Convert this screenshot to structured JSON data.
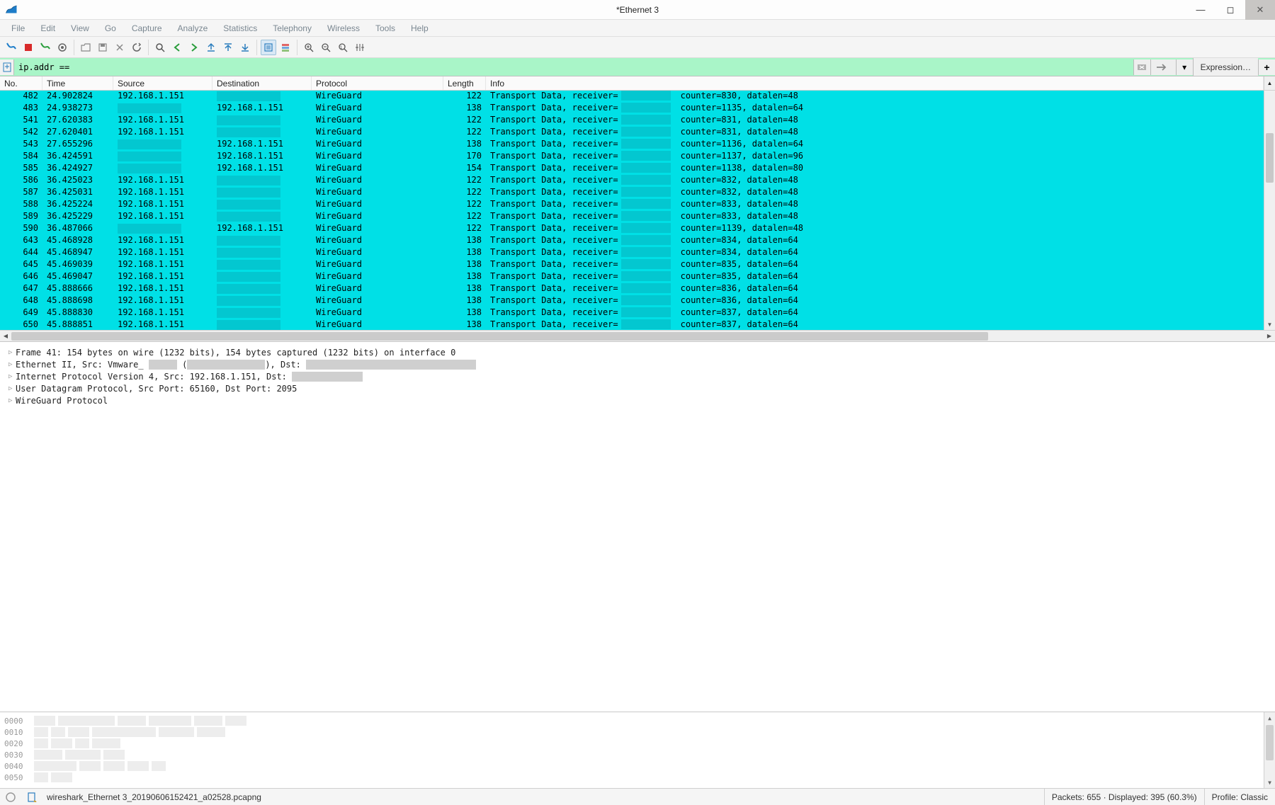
{
  "window": {
    "title": "*Ethernet 3"
  },
  "menu": [
    "File",
    "Edit",
    "View",
    "Go",
    "Capture",
    "Analyze",
    "Statistics",
    "Telephony",
    "Wireless",
    "Tools",
    "Help"
  ],
  "filter": {
    "value": "ip.addr ==",
    "expression_label": "Expression…"
  },
  "columns": {
    "no": "No.",
    "time": "Time",
    "source": "Source",
    "destination": "Destination",
    "protocol": "Protocol",
    "length": "Length",
    "info": "Info"
  },
  "packets": [
    {
      "no": "482",
      "time": "24.902824",
      "src": "192.168.1.151",
      "dst": "",
      "proto": "WireGuard",
      "len": "122",
      "info_pre": "Transport Data, receiver=",
      "info_post": "counter=830, datalen=48"
    },
    {
      "no": "483",
      "time": "24.938273",
      "src": "",
      "dst": "192.168.1.151",
      "proto": "WireGuard",
      "len": "138",
      "info_pre": "Transport Data, receiver=",
      "info_post": "counter=1135, datalen=64"
    },
    {
      "no": "541",
      "time": "27.620383",
      "src": "192.168.1.151",
      "dst": "",
      "proto": "WireGuard",
      "len": "122",
      "info_pre": "Transport Data, receiver=",
      "info_post": "counter=831, datalen=48"
    },
    {
      "no": "542",
      "time": "27.620401",
      "src": "192.168.1.151",
      "dst": "",
      "proto": "WireGuard",
      "len": "122",
      "info_pre": "Transport Data, receiver=",
      "info_post": "counter=831, datalen=48"
    },
    {
      "no": "543",
      "time": "27.655296",
      "src": "",
      "dst": "192.168.1.151",
      "proto": "WireGuard",
      "len": "138",
      "info_pre": "Transport Data, receiver=",
      "info_post": "counter=1136, datalen=64"
    },
    {
      "no": "584",
      "time": "36.424591",
      "src": "",
      "dst": "192.168.1.151",
      "proto": "WireGuard",
      "len": "170",
      "info_pre": "Transport Data, receiver=",
      "info_post": "counter=1137, datalen=96"
    },
    {
      "no": "585",
      "time": "36.424927",
      "src": "",
      "dst": "192.168.1.151",
      "proto": "WireGuard",
      "len": "154",
      "info_pre": "Transport Data, receiver=",
      "info_post": "counter=1138, datalen=80"
    },
    {
      "no": "586",
      "time": "36.425023",
      "src": "192.168.1.151",
      "dst": "",
      "proto": "WireGuard",
      "len": "122",
      "info_pre": "Transport Data, receiver=",
      "info_post": "counter=832, datalen=48"
    },
    {
      "no": "587",
      "time": "36.425031",
      "src": "192.168.1.151",
      "dst": "",
      "proto": "WireGuard",
      "len": "122",
      "info_pre": "Transport Data, receiver=",
      "info_post": "counter=832, datalen=48"
    },
    {
      "no": "588",
      "time": "36.425224",
      "src": "192.168.1.151",
      "dst": "",
      "proto": "WireGuard",
      "len": "122",
      "info_pre": "Transport Data, receiver=",
      "info_post": "counter=833, datalen=48"
    },
    {
      "no": "589",
      "time": "36.425229",
      "src": "192.168.1.151",
      "dst": "",
      "proto": "WireGuard",
      "len": "122",
      "info_pre": "Transport Data, receiver=",
      "info_post": "counter=833, datalen=48"
    },
    {
      "no": "590",
      "time": "36.487066",
      "src": "",
      "dst": "192.168.1.151",
      "proto": "WireGuard",
      "len": "122",
      "info_pre": "Transport Data, receiver=",
      "info_post": "counter=1139, datalen=48"
    },
    {
      "no": "643",
      "time": "45.468928",
      "src": "192.168.1.151",
      "dst": "",
      "proto": "WireGuard",
      "len": "138",
      "info_pre": "Transport Data, receiver=",
      "info_post": "counter=834, datalen=64"
    },
    {
      "no": "644",
      "time": "45.468947",
      "src": "192.168.1.151",
      "dst": "",
      "proto": "WireGuard",
      "len": "138",
      "info_pre": "Transport Data, receiver=",
      "info_post": "counter=834, datalen=64"
    },
    {
      "no": "645",
      "time": "45.469039",
      "src": "192.168.1.151",
      "dst": "",
      "proto": "WireGuard",
      "len": "138",
      "info_pre": "Transport Data, receiver=",
      "info_post": "counter=835, datalen=64"
    },
    {
      "no": "646",
      "time": "45.469047",
      "src": "192.168.1.151",
      "dst": "",
      "proto": "WireGuard",
      "len": "138",
      "info_pre": "Transport Data, receiver=",
      "info_post": "counter=835, datalen=64"
    },
    {
      "no": "647",
      "time": "45.888666",
      "src": "192.168.1.151",
      "dst": "",
      "proto": "WireGuard",
      "len": "138",
      "info_pre": "Transport Data, receiver=",
      "info_post": "counter=836, datalen=64"
    },
    {
      "no": "648",
      "time": "45.888698",
      "src": "192.168.1.151",
      "dst": "",
      "proto": "WireGuard",
      "len": "138",
      "info_pre": "Transport Data, receiver=",
      "info_post": "counter=836, datalen=64"
    },
    {
      "no": "649",
      "time": "45.888830",
      "src": "192.168.1.151",
      "dst": "",
      "proto": "WireGuard",
      "len": "138",
      "info_pre": "Transport Data, receiver=",
      "info_post": "counter=837, datalen=64"
    },
    {
      "no": "650",
      "time": "45.888851",
      "src": "192.168.1.151",
      "dst": "",
      "proto": "WireGuard",
      "len": "138",
      "info_pre": "Transport Data, receiver=",
      "info_post": "counter=837, datalen=64"
    }
  ],
  "details": {
    "l0": "Frame 41: 154 bytes on wire (1232 bits), 154 bytes captured (1232 bits) on interface 0",
    "l1": "Ethernet II, Src: Vmware_",
    "l1b": "(",
    "l1c": "), Dst:",
    "l2": "Internet Protocol Version 4, Src: 192.168.1.151, Dst:",
    "l3": "User Datagram Protocol, Src Port: 65160, Dst Port: 2095",
    "l4": "WireGuard Protocol"
  },
  "hex_offsets": [
    "0000",
    "0010",
    "0020",
    "0030",
    "0040",
    "0050"
  ],
  "status": {
    "filename": "wireshark_Ethernet 3_20190606152421_a02528.pcapng",
    "packets": "Packets: 655 · Displayed: 395 (60.3%)",
    "profile": "Profile: Classic"
  }
}
